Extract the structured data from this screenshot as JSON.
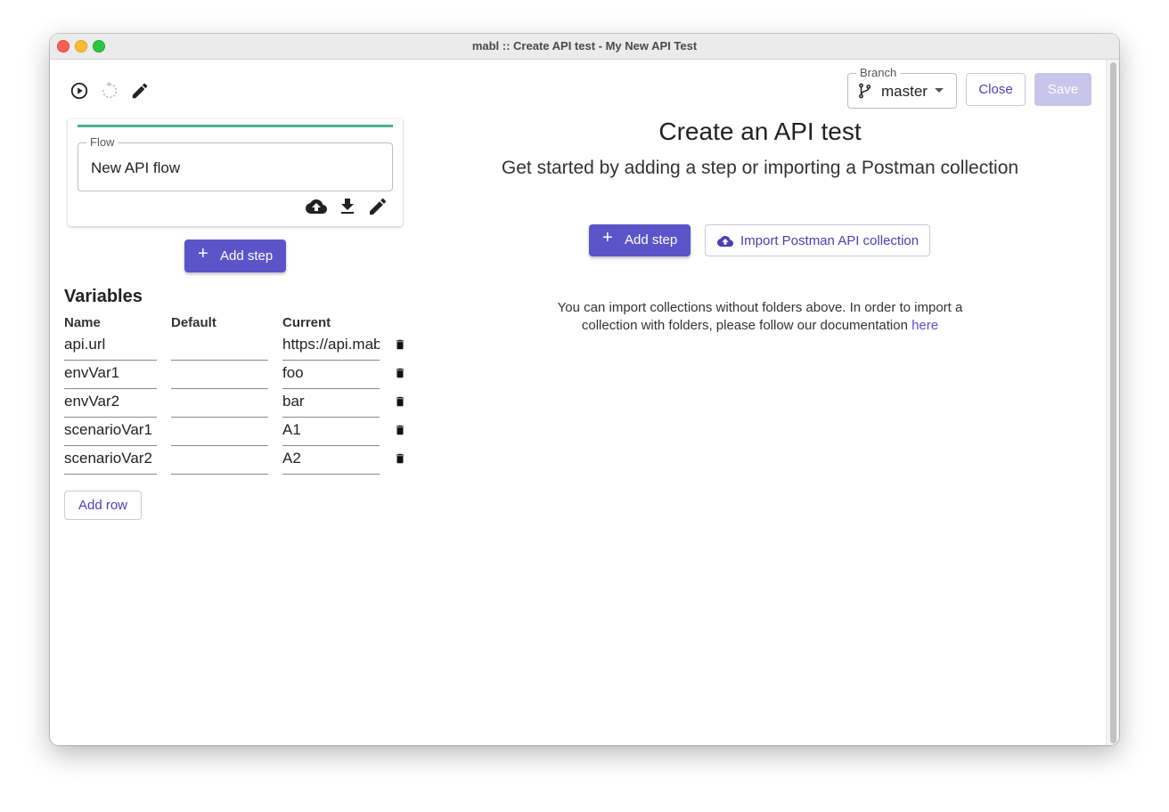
{
  "window": {
    "title": "mabl ::  Create API test - My New API Test"
  },
  "toolbar": {
    "icons": [
      "play-icon",
      "reload-icon",
      "pencil-icon"
    ]
  },
  "branch": {
    "label": "Branch",
    "value": "master"
  },
  "buttons": {
    "close": "Close",
    "save": "Save",
    "add_step": "Add step",
    "import": "Import Postman API collection",
    "add_row": "Add row"
  },
  "flow": {
    "label": "Flow",
    "value": "New API flow"
  },
  "variables": {
    "title": "Variables",
    "columns": [
      "Name",
      "Default",
      "Current"
    ],
    "rows": [
      {
        "name": "api.url",
        "default": "",
        "current": "https://api.mabl.com"
      },
      {
        "name": "envVar1",
        "default": "",
        "current": "foo"
      },
      {
        "name": "envVar2",
        "default": "",
        "current": "bar"
      },
      {
        "name": "scenarioVar1",
        "default": "",
        "current": "A1"
      },
      {
        "name": "scenarioVar2",
        "default": "",
        "current": "A2"
      }
    ]
  },
  "hero": {
    "title": "Create an API test",
    "subtitle": "Get started by adding a step or importing a Postman collection",
    "note_line1": "You can import collections without folders above. In order to import a",
    "note_line2": "collection with folders, please follow our documentation",
    "note_link": "here"
  },
  "colors": {
    "primary": "#5b54c9",
    "primary_disabled": "#c7c5ea",
    "flow_accent": "#4caf8e"
  }
}
